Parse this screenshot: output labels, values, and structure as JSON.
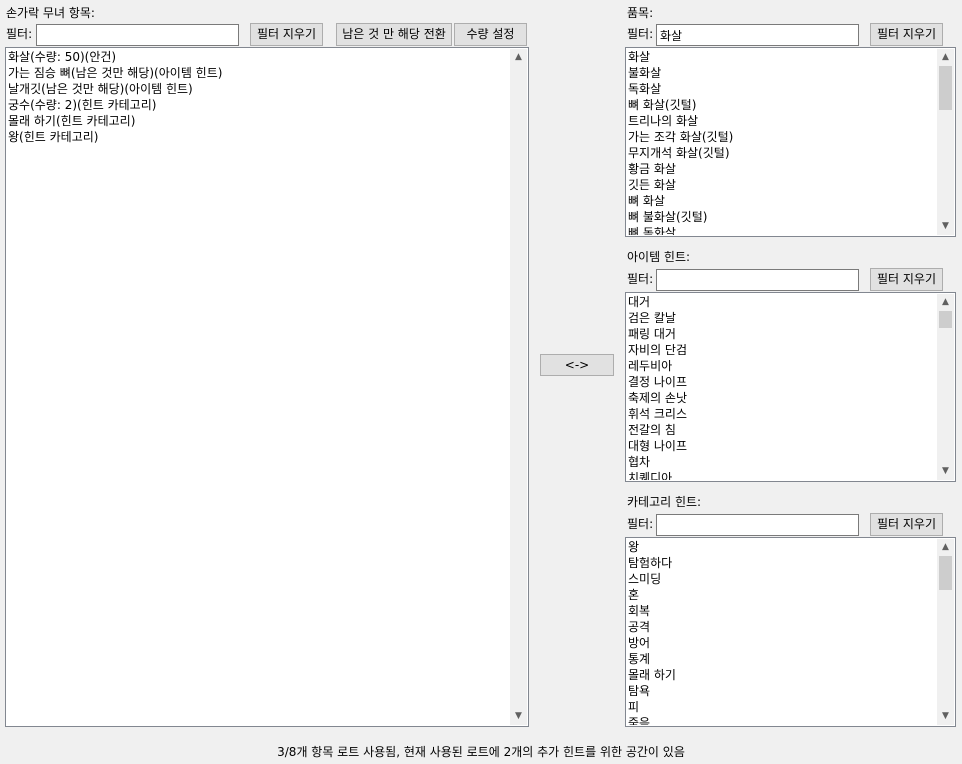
{
  "left": {
    "title": "손가락 무녀 항목:",
    "filter_label": "필터:",
    "filter_value": "",
    "clear_filter": "필터 지우기",
    "toggle_remaining": "남은 것 만 해당 전환",
    "set_quantity": "수량 설정",
    "items": [
      "화살(수량: 50)(안건)",
      "가는 짐승 뼈(남은 것만 해당)(아이템 힌트)",
      "날개깃(남은 것만 해당)(아이템 힌트)",
      "궁수(수량: 2)(힌트 카테고리)",
      "몰래 하기(힌트 카테고리)",
      "왕(힌트 카테고리)"
    ]
  },
  "swap_button": "<->",
  "items_panel": {
    "title": "품목:",
    "filter_label": "필터:",
    "filter_value": "화살",
    "clear_filter": "필터 지우기",
    "items": [
      "화살",
      "불화살",
      "독화살",
      "뼈 화살(깃털)",
      "트리나의 화살",
      "가는 조각 화살(깃털)",
      "무지개석 화살(깃털)",
      "황금 화살",
      "깃든 화살",
      "뼈 화살",
      "뼈 불화살(깃털)",
      "뼈 독화살"
    ]
  },
  "item_hints": {
    "title": "아이템 힌트:",
    "filter_label": "필터:",
    "filter_value": "",
    "clear_filter": "필터 지우기",
    "items": [
      "대거",
      "검은 칼날",
      "패링 대거",
      "자비의 단검",
      "레두비아",
      "결정 나이프",
      "축제의 손낫",
      "휘석 크리스",
      "전갈의 침",
      "대형 나이프",
      "협차",
      "치퀘디아"
    ]
  },
  "category_hints": {
    "title": "카테고리 힌트:",
    "filter_label": "필터:",
    "filter_value": "",
    "clear_filter": "필터 지우기",
    "items": [
      "왕",
      "탐험하다",
      "스미딩",
      "혼",
      "회복",
      "공격",
      "방어",
      "통계",
      "몰래 하기",
      "탐욕",
      "피",
      "죽음"
    ]
  },
  "status": "3/8개 항목 로트 사용됨, 현재 사용된 로트에 2개의 추가 힌트를 위한 공간이 있음",
  "icons": {
    "scroll_up": "▲",
    "scroll_down": "▼"
  }
}
